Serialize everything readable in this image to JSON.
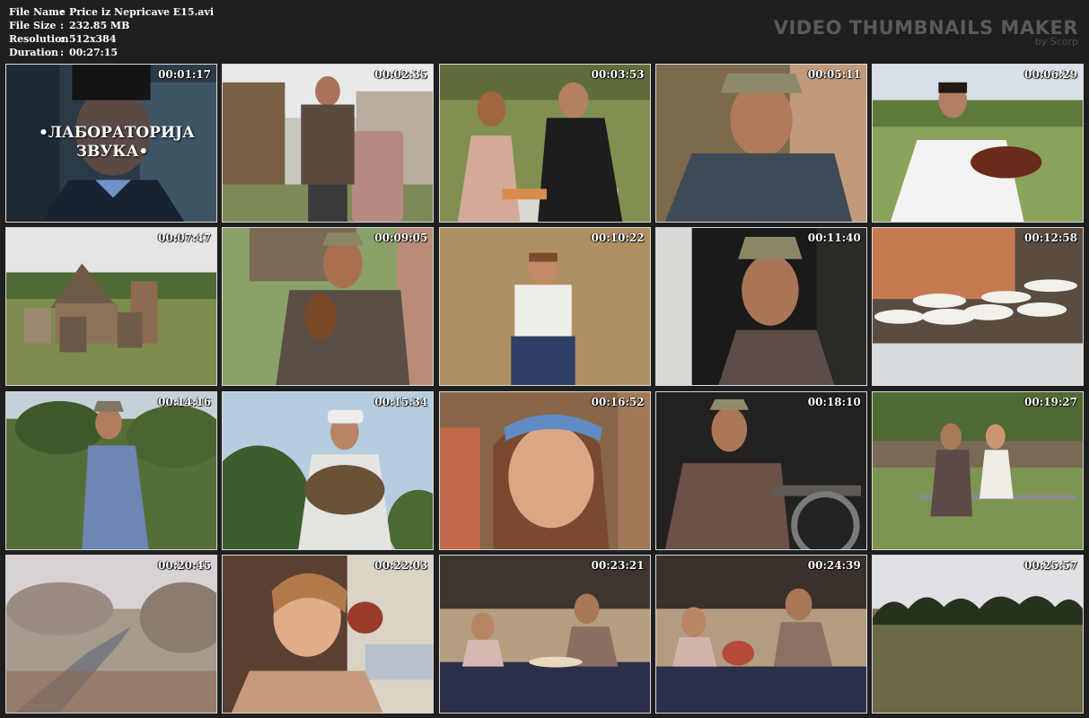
{
  "file_info": {
    "file_name_label": "File Name",
    "file_name": "Price iz Nepricave E15.avi",
    "file_size_label": "File Size",
    "file_size": "232.85 MB",
    "resolution_label": "Resolution",
    "resolution": "512x384",
    "duration_label": "Duration",
    "duration": "00:27:15",
    "separator": ":"
  },
  "brand": {
    "title": "VIDEO THUMBNAILS MAKER",
    "subtitle": "by Scorp"
  },
  "thumbnails": [
    {
      "time": "00:01:17",
      "overlay_line1": "•ЛАБОРАТОРИЈА",
      "overlay_line2": "ЗВУКА•",
      "scene": "title-card-portrait"
    },
    {
      "time": "00:02:35",
      "scene": "man-with-barrel"
    },
    {
      "time": "00:03:53",
      "scene": "two-women-at-table"
    },
    {
      "time": "00:05:11",
      "scene": "man-closeup-hat"
    },
    {
      "time": "00:06:29",
      "scene": "violinist-in-field"
    },
    {
      "time": "00:07:47",
      "scene": "farmyard-group"
    },
    {
      "time": "00:09:05",
      "scene": "man-with-gourd"
    },
    {
      "time": "00:10:22",
      "scene": "boy-on-haystack"
    },
    {
      "time": "00:11:40",
      "scene": "man-portrait-door"
    },
    {
      "time": "00:12:58",
      "scene": "dough-on-stove"
    },
    {
      "time": "00:14:16",
      "scene": "man-in-orchard"
    },
    {
      "time": "00:15:34",
      "scene": "man-with-sieve"
    },
    {
      "time": "00:16:52",
      "scene": "girl-with-headband"
    },
    {
      "time": "00:18:10",
      "scene": "man-by-wheel"
    },
    {
      "time": "00:19:27",
      "scene": "couple-on-bench"
    },
    {
      "time": "00:20:45",
      "scene": "misty-stream"
    },
    {
      "time": "00:22:03",
      "scene": "woman-in-kitchen"
    },
    {
      "time": "00:23:21",
      "scene": "couple-at-dinner"
    },
    {
      "time": "00:24:39",
      "scene": "couple-at-dinner-2"
    },
    {
      "time": "00:25:57",
      "scene": "treeline-field"
    }
  ]
}
